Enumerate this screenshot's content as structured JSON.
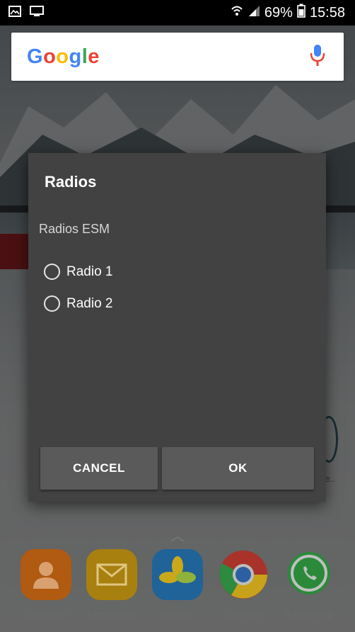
{
  "status_bar": {
    "battery": "69%",
    "time": "15:58",
    "left_icons": [
      "gallery-icon",
      "cast-icon"
    ],
    "right_icons": [
      "wifi-icon",
      "signal-icon",
      "battery-icon"
    ]
  },
  "search": {
    "logo": "Google",
    "logo_colors": [
      "#4285F4",
      "#EA4335",
      "#FBBC05",
      "#4285F4",
      "#34A853",
      "#EA4335"
    ]
  },
  "dialog": {
    "title": "Radios",
    "message": "Radios ESM",
    "options": [
      {
        "label": "Radio 1",
        "selected": false
      },
      {
        "label": "Radio 2",
        "selected": false
      }
    ],
    "cancel_label": "CANCEL",
    "ok_label": "OK"
  },
  "dock": {
    "apps": [
      {
        "label": "Contacts",
        "color": "#e97b1a",
        "icon": "contacts-icon"
      },
      {
        "label": "Messages",
        "color": "#f2b51b",
        "icon": "messages-icon"
      },
      {
        "label": "Gallery",
        "color": "#2e8ed8",
        "icon": "gallery-app-icon"
      },
      {
        "label": "Chrome",
        "color": "#ffffff",
        "icon": "chrome-icon"
      },
      {
        "label": "WhatsApp",
        "color": "#3ec84f",
        "icon": "whatsapp-icon"
      }
    ]
  },
  "colors": {
    "dialog_bg": "#424242",
    "button_bg": "#5a5a5a"
  }
}
